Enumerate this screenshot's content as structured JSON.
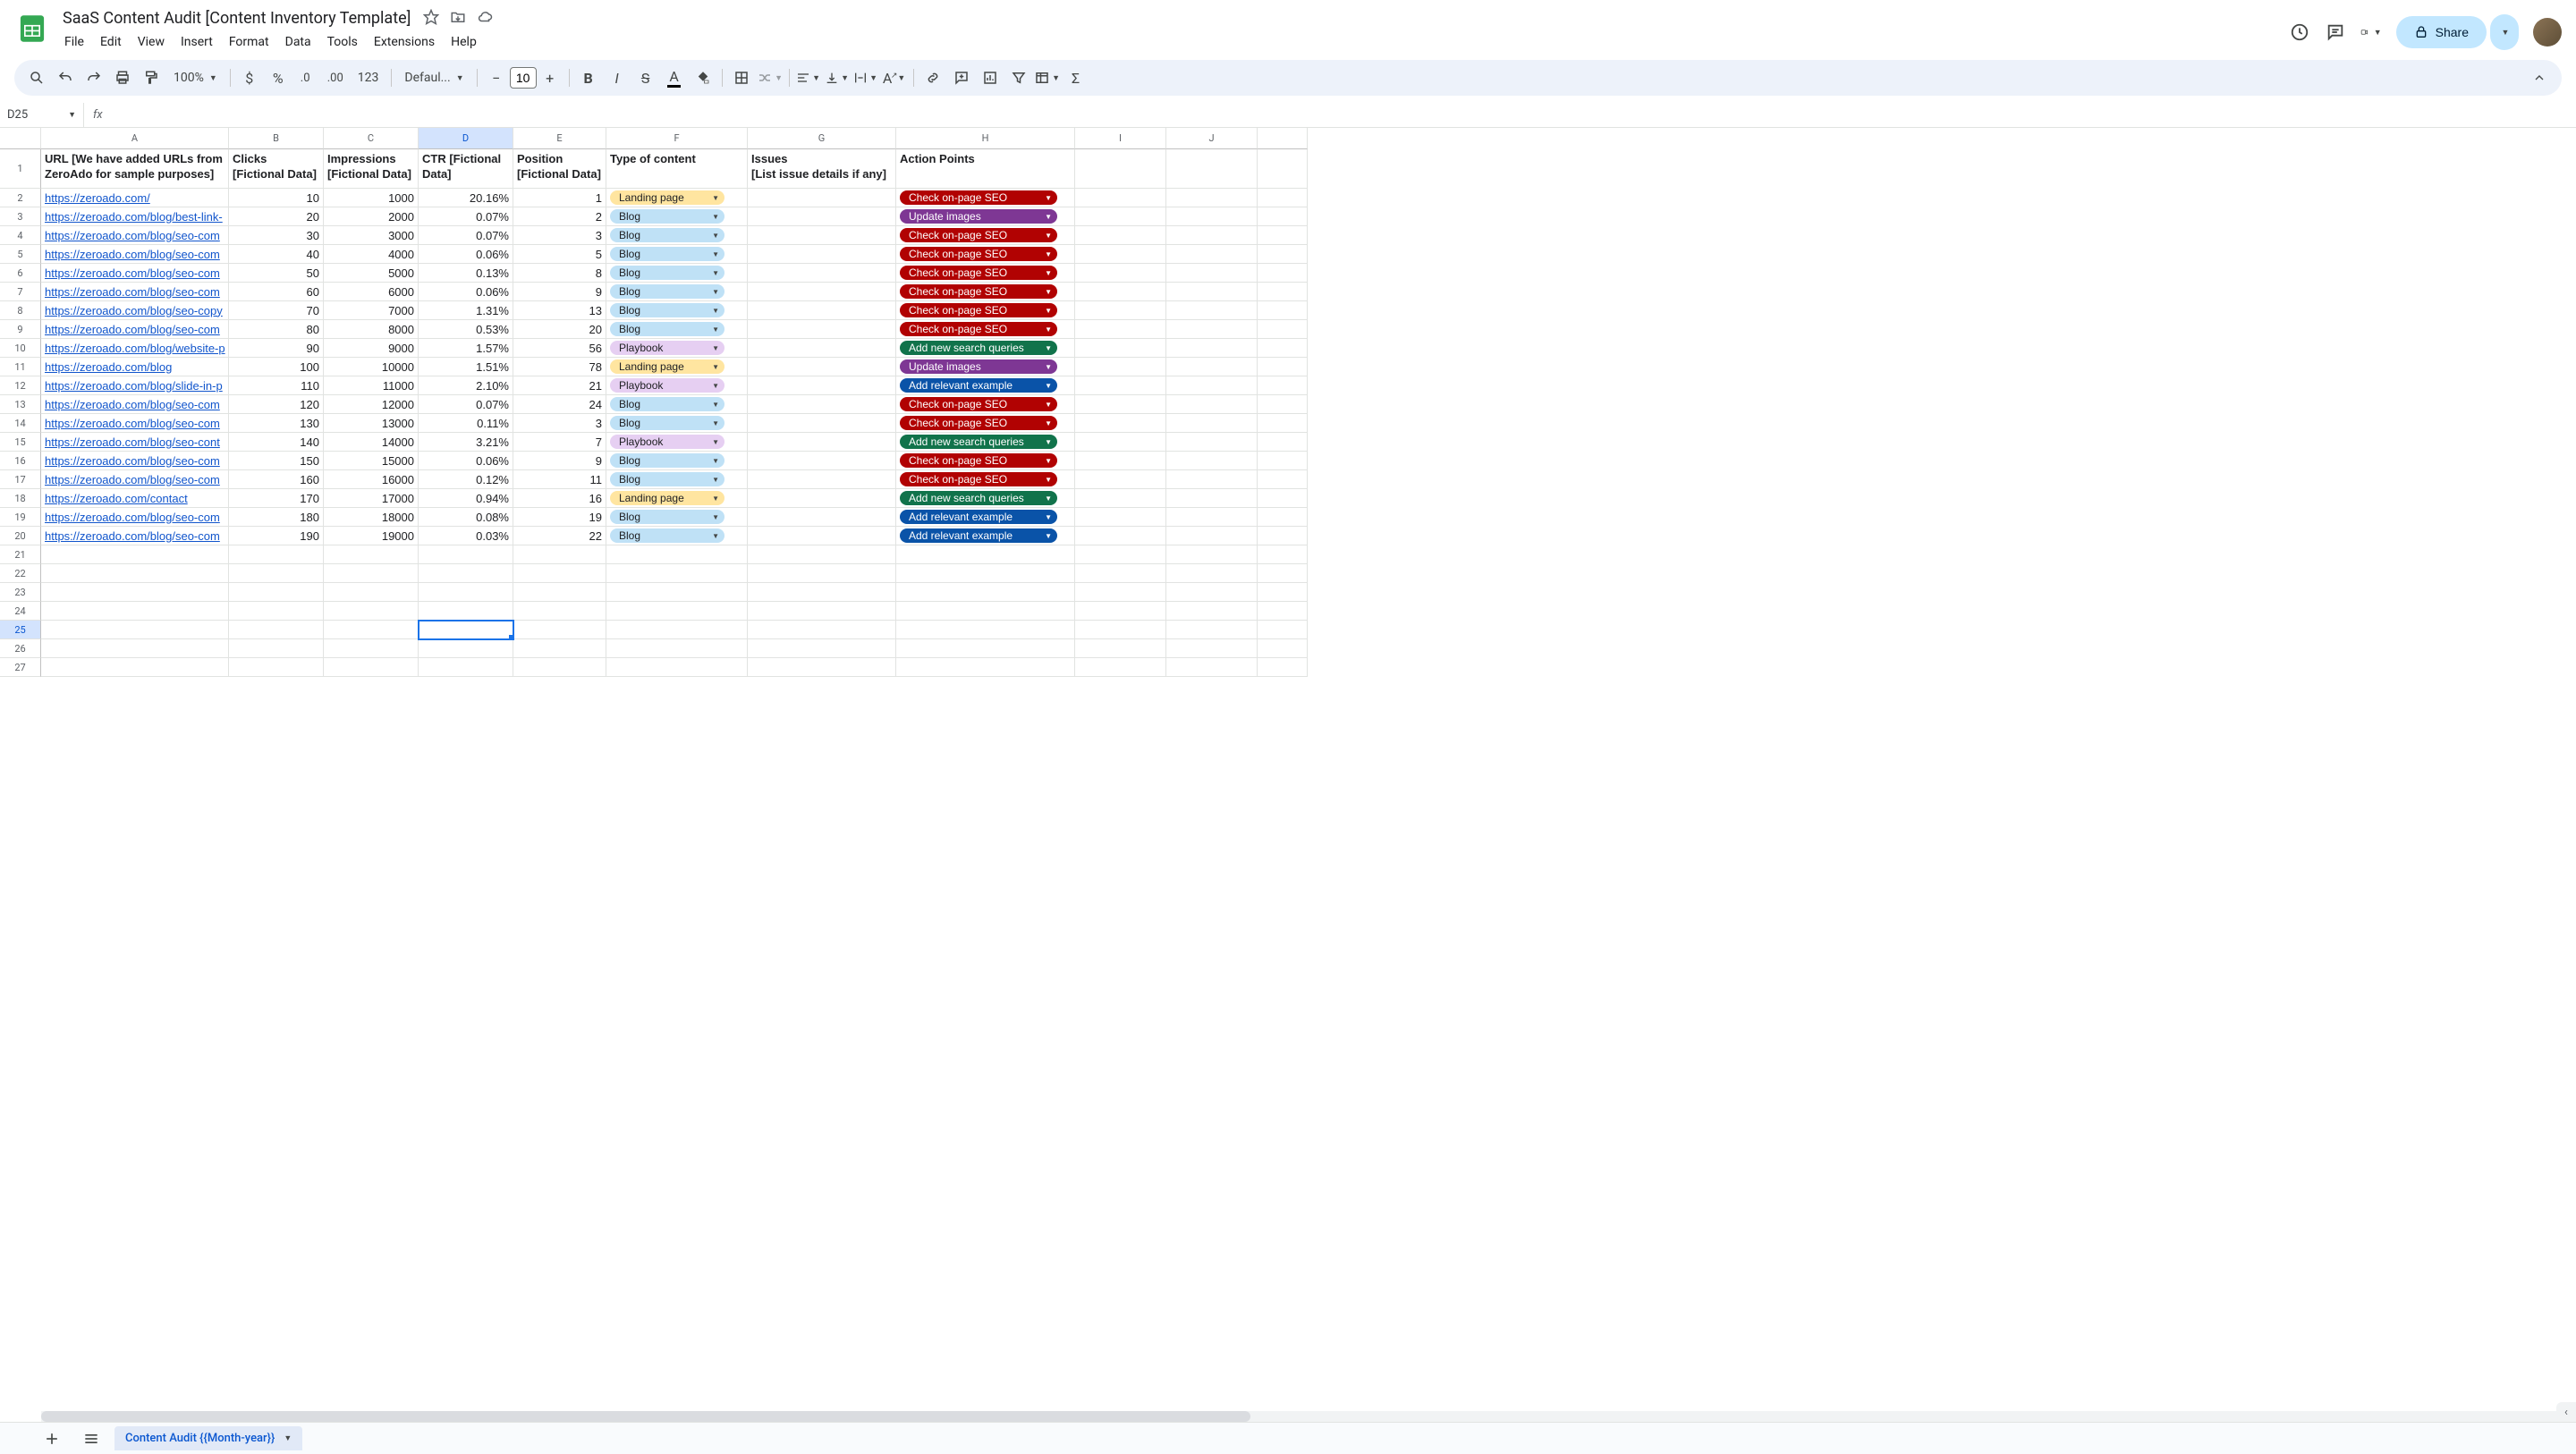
{
  "doc": {
    "title": "SaaS Content Audit [Content Inventory Template]"
  },
  "menu": [
    "File",
    "Edit",
    "View",
    "Insert",
    "Format",
    "Data",
    "Tools",
    "Extensions",
    "Help"
  ],
  "share": {
    "label": "Share"
  },
  "toolbar": {
    "zoom": "100%",
    "format_num": "123",
    "font": "Defaul...",
    "font_size": "10"
  },
  "name_box": "D25",
  "columns": [
    "A",
    "B",
    "C",
    "D",
    "E",
    "F",
    "G",
    "H",
    "I",
    "J",
    ""
  ],
  "headers": {
    "A": "URL [We have added URLs from ZeroAdo for sample purposes]",
    "B": "Clicks [Fictional Data]",
    "C": "Impressions [Fictional Data]",
    "D": "CTR [Fictional Data]",
    "E": "Position [Fictional Data]",
    "F": "Type of content",
    "G": "Issues\n[List issue details if any]",
    "H": "Action Points"
  },
  "content_types": {
    "landing": "Landing page",
    "blog": "Blog",
    "playbook": "Playbook"
  },
  "actions": {
    "check": "Check on-page SEO",
    "update": "Update images",
    "addq": "Add new search queries",
    "addex": "Add relevant example"
  },
  "rows": [
    {
      "url": "https://zeroado.com/",
      "clicks": "10",
      "imp": "1000",
      "ctr": "20.16%",
      "pos": "1",
      "type": "landing",
      "action": "check"
    },
    {
      "url": "https://zeroado.com/blog/best-link-",
      "clicks": "20",
      "imp": "2000",
      "ctr": "0.07%",
      "pos": "2",
      "type": "blog",
      "action": "update"
    },
    {
      "url": "https://zeroado.com/blog/seo-com",
      "clicks": "30",
      "imp": "3000",
      "ctr": "0.07%",
      "pos": "3",
      "type": "blog",
      "action": "check"
    },
    {
      "url": "https://zeroado.com/blog/seo-com",
      "clicks": "40",
      "imp": "4000",
      "ctr": "0.06%",
      "pos": "5",
      "type": "blog",
      "action": "check"
    },
    {
      "url": "https://zeroado.com/blog/seo-com",
      "clicks": "50",
      "imp": "5000",
      "ctr": "0.13%",
      "pos": "8",
      "type": "blog",
      "action": "check"
    },
    {
      "url": "https://zeroado.com/blog/seo-com",
      "clicks": "60",
      "imp": "6000",
      "ctr": "0.06%",
      "pos": "9",
      "type": "blog",
      "action": "check"
    },
    {
      "url": "https://zeroado.com/blog/seo-copy",
      "clicks": "70",
      "imp": "7000",
      "ctr": "1.31%",
      "pos": "13",
      "type": "blog",
      "action": "check"
    },
    {
      "url": "https://zeroado.com/blog/seo-com",
      "clicks": "80",
      "imp": "8000",
      "ctr": "0.53%",
      "pos": "20",
      "type": "blog",
      "action": "check"
    },
    {
      "url": "https://zeroado.com/blog/website-p",
      "clicks": "90",
      "imp": "9000",
      "ctr": "1.57%",
      "pos": "56",
      "type": "playbook",
      "action": "addq"
    },
    {
      "url": "https://zeroado.com/blog",
      "clicks": "100",
      "imp": "10000",
      "ctr": "1.51%",
      "pos": "78",
      "type": "landing",
      "action": "update"
    },
    {
      "url": "https://zeroado.com/blog/slide-in-p",
      "clicks": "110",
      "imp": "11000",
      "ctr": "2.10%",
      "pos": "21",
      "type": "playbook",
      "action": "addex"
    },
    {
      "url": "https://zeroado.com/blog/seo-com",
      "clicks": "120",
      "imp": "12000",
      "ctr": "0.07%",
      "pos": "24",
      "type": "blog",
      "action": "check"
    },
    {
      "url": "https://zeroado.com/blog/seo-com",
      "clicks": "130",
      "imp": "13000",
      "ctr": "0.11%",
      "pos": "3",
      "type": "blog",
      "action": "check"
    },
    {
      "url": "https://zeroado.com/blog/seo-cont",
      "clicks": "140",
      "imp": "14000",
      "ctr": "3.21%",
      "pos": "7",
      "type": "playbook",
      "action": "addq"
    },
    {
      "url": "https://zeroado.com/blog/seo-com",
      "clicks": "150",
      "imp": "15000",
      "ctr": "0.06%",
      "pos": "9",
      "type": "blog",
      "action": "check"
    },
    {
      "url": "https://zeroado.com/blog/seo-com",
      "clicks": "160",
      "imp": "16000",
      "ctr": "0.12%",
      "pos": "11",
      "type": "blog",
      "action": "check"
    },
    {
      "url": "https://zeroado.com/contact",
      "clicks": "170",
      "imp": "17000",
      "ctr": "0.94%",
      "pos": "16",
      "type": "landing",
      "action": "addq"
    },
    {
      "url": "https://zeroado.com/blog/seo-com",
      "clicks": "180",
      "imp": "18000",
      "ctr": "0.08%",
      "pos": "19",
      "type": "blog",
      "action": "addex"
    },
    {
      "url": "https://zeroado.com/blog/seo-com",
      "clicks": "190",
      "imp": "19000",
      "ctr": "0.03%",
      "pos": "22",
      "type": "blog",
      "action": "addex"
    }
  ],
  "empty_rows": [
    21,
    22,
    23,
    24,
    25,
    26,
    27
  ],
  "selected_row": 25,
  "sheet_tab": "Content Audit {{Month-year}}"
}
